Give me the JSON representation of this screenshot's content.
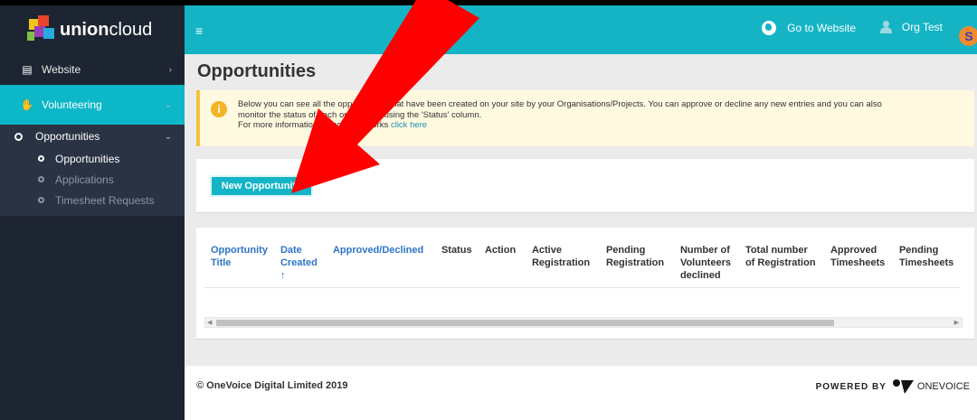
{
  "brand": {
    "union": "union",
    "cloud": "cloud"
  },
  "sidebar": {
    "items": [
      {
        "label": "Website"
      },
      {
        "label": "Volunteering"
      }
    ],
    "subgroup": {
      "label": "Opportunities",
      "items": [
        {
          "label": "Opportunities"
        },
        {
          "label": "Applications"
        },
        {
          "label": "Timesheet Requests"
        }
      ]
    }
  },
  "topbar": {
    "goto_label": "Go to Website",
    "user_label": "Org Test",
    "avatar_letter": "S"
  },
  "page": {
    "title": "Opportunities",
    "alert": {
      "line1": "Below you can see all the opportunities that have been created on your site by your Organisations/Projects. You can approve or decline any new entries and you can also",
      "line2": "monitor the status of each opportunity using the 'Status' column.",
      "line3": "For more information on how this works ",
      "link": "click here"
    },
    "new_button": "New Opportunity",
    "table": {
      "headers": [
        "Opportunity Title",
        "Date Created",
        "Approved/Declined",
        "Status",
        "Action",
        "Active Registration",
        "Pending Registration",
        "Number of Volunteers declined",
        "Total number of Registration",
        "Approved Timesheets",
        "Pending Timesheets"
      ],
      "sort_arrow": "↑"
    }
  },
  "footer": {
    "copyright": "© OneVoice Digital Limited 2019",
    "powered_by": "POWERED BY",
    "brand": "ONEVOICE"
  },
  "colors": {
    "accent": "#14b4c5",
    "sidebar": "#1e2532",
    "arrow": "#ff0000"
  }
}
